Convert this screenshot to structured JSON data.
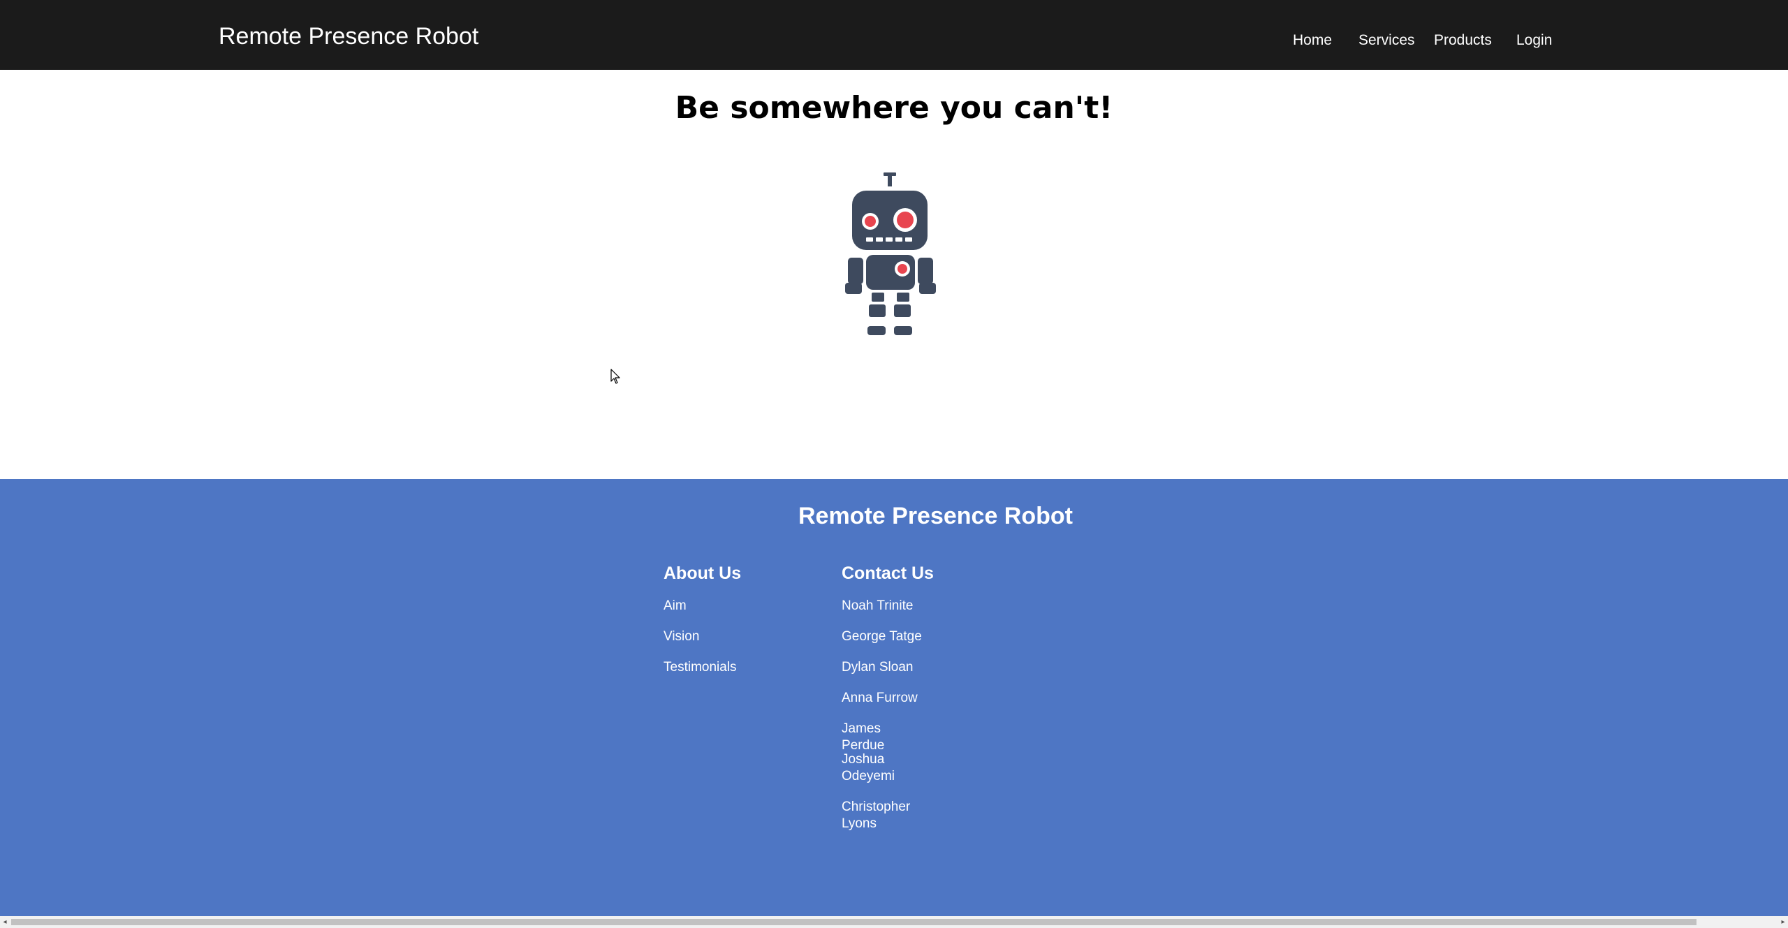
{
  "header": {
    "brand": "Remote Presence Robot",
    "nav": [
      "Home",
      "Services",
      "Products",
      "Login"
    ]
  },
  "hero": {
    "title": "Be somewhere you can't!",
    "image_icon": "robot-icon"
  },
  "footer": {
    "title": "Remote Presence Robot",
    "about": {
      "heading": "About Us",
      "items": [
        "Aim",
        "Vision",
        "Testimonials"
      ]
    },
    "contact": {
      "heading": "Contact Us",
      "items": [
        "Noah Trinite",
        "George Tatge",
        "Dylan Sloan",
        "Anna Furrow",
        "James Perdue",
        "Joshua Odeyemi",
        "Christopher Lyons"
      ]
    }
  },
  "colors": {
    "navbar": "#1b1b1b",
    "footer": "#4e76c4",
    "robot_body": "#3e4a5e",
    "robot_eye": "#e8454f"
  },
  "scrollbar": {
    "left_arrow": "◂",
    "right_arrow": "▸"
  }
}
